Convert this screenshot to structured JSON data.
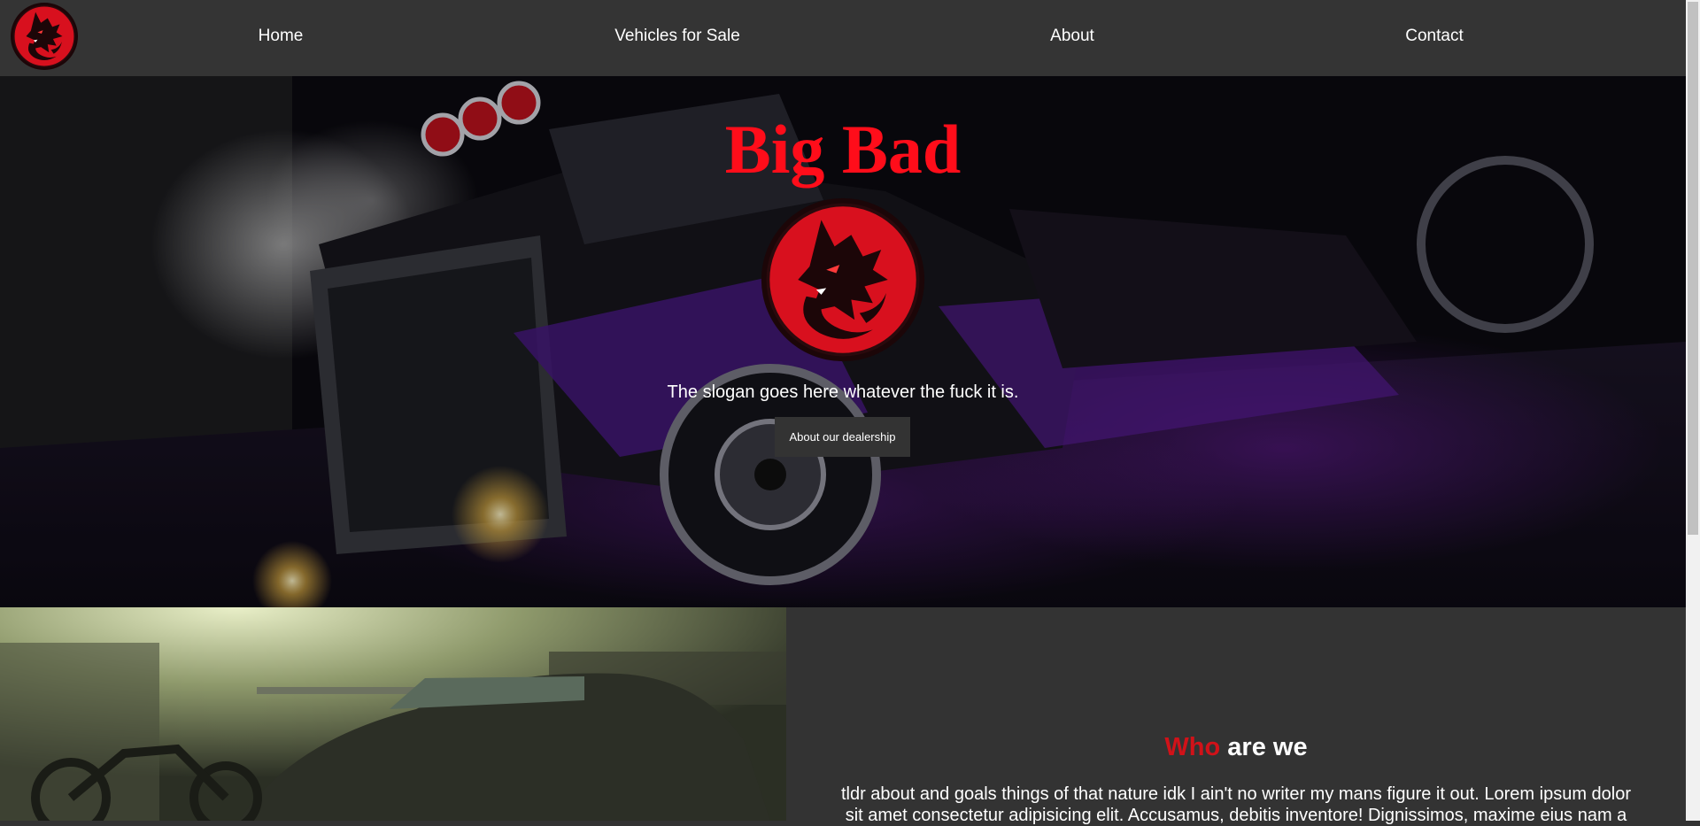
{
  "nav": {
    "logo_name": "wolf-logo",
    "links": [
      {
        "label": "Home"
      },
      {
        "label": "Vehicles for Sale"
      },
      {
        "label": "About"
      },
      {
        "label": "Contact"
      }
    ]
  },
  "hero": {
    "title": "Big Bad",
    "logo_name": "wolf-emblem",
    "slogan": "The slogan goes here whatever the fuck it is.",
    "button_label": "About our dealership",
    "background": "hot-rod-truck-photo"
  },
  "about": {
    "heading_accent": "Who",
    "heading_rest": "are we",
    "text": "tldr about and goals things of that nature idk I ain't no writer my mans figure it out. Lorem ipsum dolor sit amet consectetur adipisicing elit. Accusamus, debitis inventore! Dignissimos, maxime eius nam a",
    "image": "garage-car-motorcycle-photo"
  },
  "colors": {
    "accent": "#ff0d1a",
    "heading_accent": "#d11219",
    "navbar": "#343434",
    "page_bg": "#333333"
  }
}
